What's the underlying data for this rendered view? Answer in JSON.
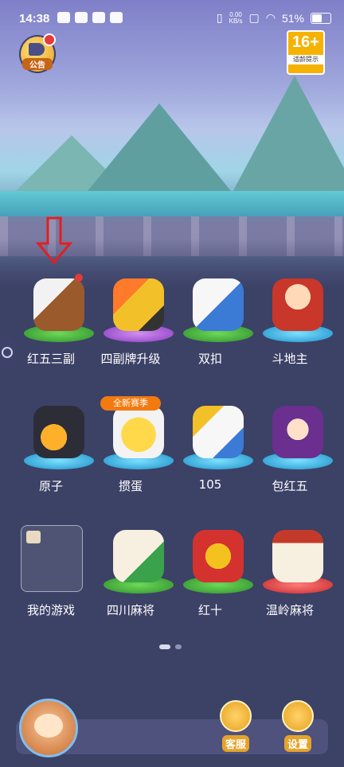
{
  "status_bar": {
    "time": "14:38",
    "net_speed": "0.00",
    "net_unit": "KB/s",
    "battery": "51%"
  },
  "header": {
    "announce_label": "公告",
    "age_rating": "16+",
    "age_rating_sub": "适龄提示"
  },
  "games": [
    {
      "name": "红五三副"
    },
    {
      "name": "四副牌升级"
    },
    {
      "name": "双扣"
    },
    {
      "name": "斗地主"
    },
    {
      "name": "原子"
    },
    {
      "name": "掼蛋",
      "tag": "全新赛季"
    },
    {
      "name": "105"
    },
    {
      "name": "包红五"
    },
    {
      "name": "我的游戏"
    },
    {
      "name": "四川麻将"
    },
    {
      "name": "红十"
    },
    {
      "name": "温岭麻将"
    }
  ],
  "bottom": {
    "service_label": "客服",
    "settings_label": "设置"
  },
  "colors": {
    "background": "#3c4166",
    "accent_orange": "#f37a10",
    "badge_yellow": "#f5b200",
    "notify_red": "#e53a3a"
  }
}
